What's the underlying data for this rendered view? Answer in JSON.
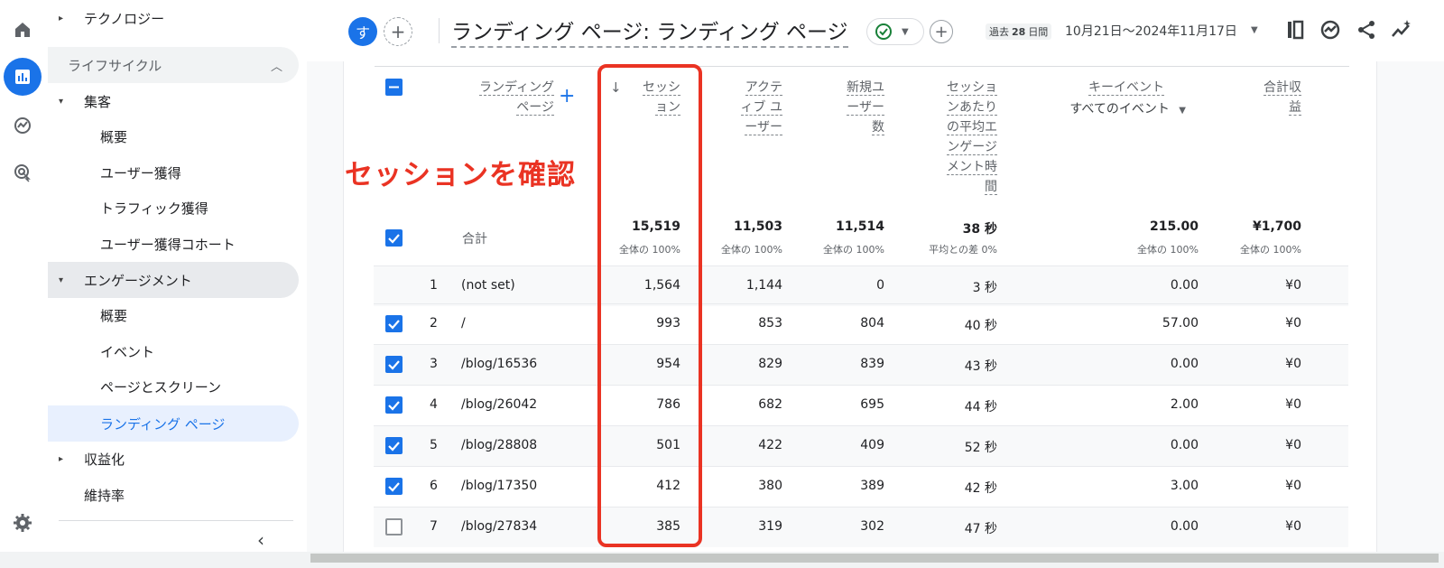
{
  "sidebar": {
    "items": [
      {
        "label": "テクノロジー"
      },
      {
        "label": "ライフサイクル"
      },
      {
        "label": "集客"
      },
      {
        "label": "概要"
      },
      {
        "label": "ユーザー獲得"
      },
      {
        "label": "トラフィック獲得"
      },
      {
        "label": "ユーザー獲得コホート"
      },
      {
        "label": "エンゲージメント"
      },
      {
        "label": "概要"
      },
      {
        "label": "イベント"
      },
      {
        "label": "ページとスクリーン"
      },
      {
        "label": "ランディング ページ"
      },
      {
        "label": "収益化"
      },
      {
        "label": "維持率"
      }
    ]
  },
  "header": {
    "avatar_letter": "す",
    "title": "ランディング ページ: ランディング ページ",
    "range_prefix": "過去",
    "range_days": "28",
    "range_suffix": "日間",
    "date_range": "10月21日～2024年11月17日"
  },
  "table": {
    "headers": {
      "landing_page": [
        "ランディング",
        "ページ"
      ],
      "sessions": [
        "セッシ",
        "ョン"
      ],
      "active_users": [
        "アクテ",
        "ィブ ユ",
        "ーザー"
      ],
      "new_users": [
        "新規ユ",
        "ーザー",
        "数"
      ],
      "avg_engagement": [
        "セッショ",
        "ンあたり",
        "の平均エ",
        "ンゲージ",
        "メント時",
        "間"
      ],
      "key_events": "キーイベント",
      "key_events_filter": "すべてのイベント",
      "revenue": [
        "合計収",
        "益"
      ]
    },
    "totals": {
      "label": "合計",
      "sessions": "15,519",
      "sessions_sub": "全体の 100%",
      "active_users": "11,503",
      "active_users_sub": "全体の 100%",
      "new_users": "11,514",
      "new_users_sub": "全体の 100%",
      "avg_engagement": "38 秒",
      "avg_engagement_sub": "平均との差 0%",
      "key_events": "215.00",
      "key_events_sub": "全体の 100%",
      "revenue": "¥1,700",
      "revenue_sub": "全体の 100%"
    },
    "rows": [
      {
        "idx": "1",
        "page": "(not set)",
        "sessions": "1,564",
        "active": "1,144",
        "new": "0",
        "avg": "3 秒",
        "events": "0.00",
        "revenue": "¥0",
        "checked": "none"
      },
      {
        "idx": "2",
        "page": "/",
        "sessions": "993",
        "active": "853",
        "new": "804",
        "avg": "40 秒",
        "events": "57.00",
        "revenue": "¥0",
        "checked": "on"
      },
      {
        "idx": "3",
        "page": "/blog/16536",
        "sessions": "954",
        "active": "829",
        "new": "839",
        "avg": "43 秒",
        "events": "0.00",
        "revenue": "¥0",
        "checked": "on"
      },
      {
        "idx": "4",
        "page": "/blog/26042",
        "sessions": "786",
        "active": "682",
        "new": "695",
        "avg": "44 秒",
        "events": "2.00",
        "revenue": "¥0",
        "checked": "on"
      },
      {
        "idx": "5",
        "page": "/blog/28808",
        "sessions": "501",
        "active": "422",
        "new": "409",
        "avg": "52 秒",
        "events": "0.00",
        "revenue": "¥0",
        "checked": "on"
      },
      {
        "idx": "6",
        "page": "/blog/17350",
        "sessions": "412",
        "active": "380",
        "new": "389",
        "avg": "42 秒",
        "events": "3.00",
        "revenue": "¥0",
        "checked": "on"
      },
      {
        "idx": "7",
        "page": "/blog/27834",
        "sessions": "385",
        "active": "319",
        "new": "302",
        "avg": "47 秒",
        "events": "0.00",
        "revenue": "¥0",
        "checked": "off"
      }
    ]
  },
  "annotation": "セッションを確認",
  "colors": {
    "accent": "#1a73e8",
    "annotation": "#ea3323",
    "success": "#188038"
  }
}
